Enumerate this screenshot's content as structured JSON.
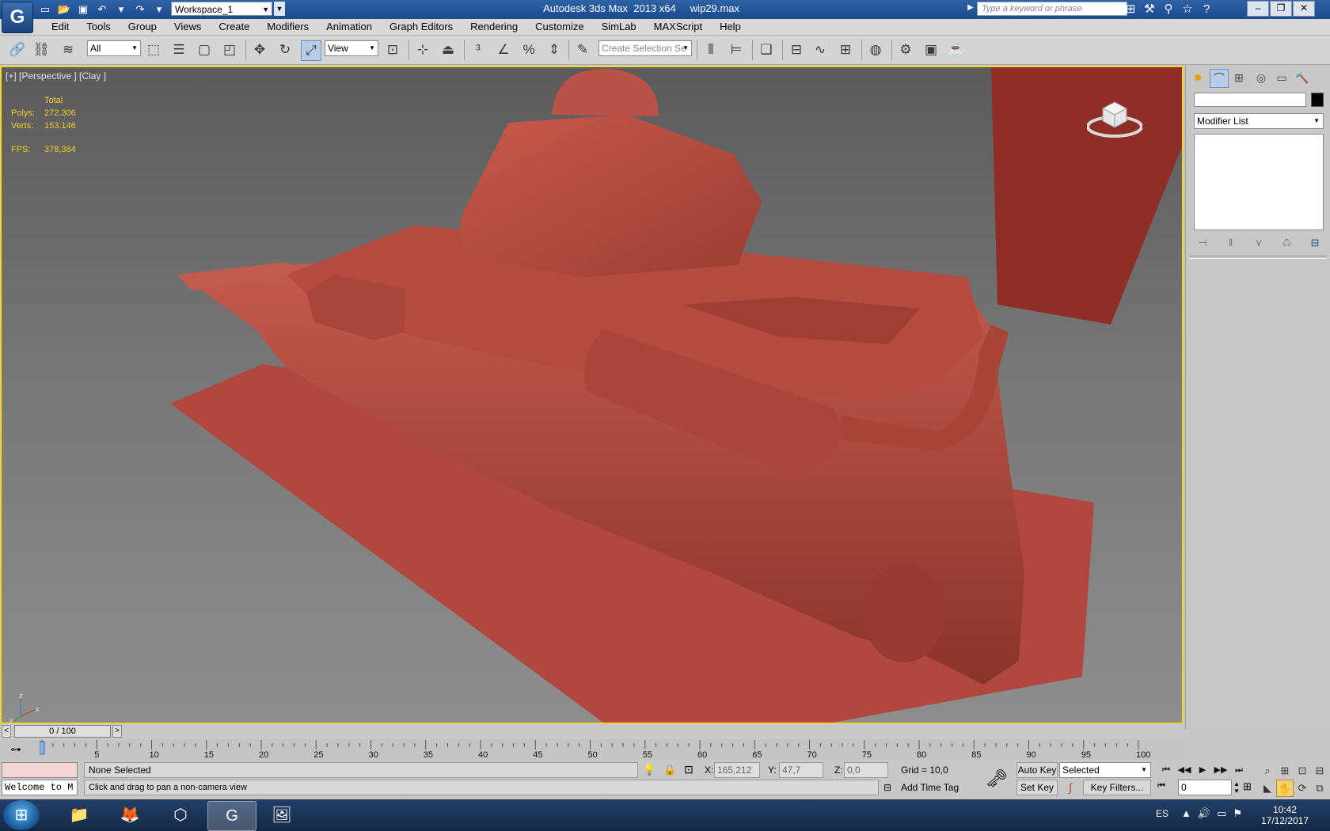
{
  "title_bar": {
    "workspace": "Workspace_1",
    "app_title": "Autodesk 3ds Max  2013 x64",
    "file_name": "wip29.max",
    "search_placeholder": "Type a keyword or phrase"
  },
  "menu": [
    "Edit",
    "Tools",
    "Group",
    "Views",
    "Create",
    "Modifiers",
    "Animation",
    "Graph Editors",
    "Rendering",
    "Customize",
    "SimLab",
    "MAXScript",
    "Help"
  ],
  "toolbar": {
    "selection_filter": "All",
    "reference_coord": "View",
    "named_selection_placeholder": "Create Selection Se"
  },
  "viewport": {
    "label": "[+] [Perspective ] [Clay ]",
    "stats": {
      "total_label": "Total",
      "polys_label": "Polys:",
      "polys_value": "272.306",
      "verts_label": "Verts:",
      "verts_value": "153.146",
      "fps_label": "FPS:",
      "fps_value": "378,384"
    },
    "axis": {
      "x": "x",
      "y": "y",
      "z": "z"
    }
  },
  "command_panel": {
    "modifier_list": "Modifier List"
  },
  "time_slider": {
    "position": "0 / 100",
    "ticks": [
      "5",
      "10",
      "15",
      "20",
      "25",
      "30",
      "35",
      "40",
      "45",
      "50",
      "55",
      "60",
      "65",
      "70",
      "75",
      "80",
      "85",
      "90",
      "95",
      "100"
    ]
  },
  "status": {
    "welcome": "Welcome to M",
    "selection": "None Selected",
    "prompt": "Click and drag to pan a non-camera view",
    "x_label": "X:",
    "x_value": "165,212",
    "y_label": "Y:",
    "y_value": "47,7",
    "z_label": "Z:",
    "z_value": "0,0",
    "grid": "Grid = 10,0",
    "add_time_tag": "Add Time Tag",
    "auto_key": "Auto Key",
    "set_key": "Set Key",
    "selected_dropdown": "Selected",
    "key_filters": "Key Filters...",
    "frame": "0"
  },
  "taskbar": {
    "language": "ES",
    "time": "10:42",
    "date": "17/12/2017"
  },
  "colors": {
    "clay": "#b24a40",
    "viewport_border": "#f6d43a",
    "title_bar": "#1f4f92"
  }
}
